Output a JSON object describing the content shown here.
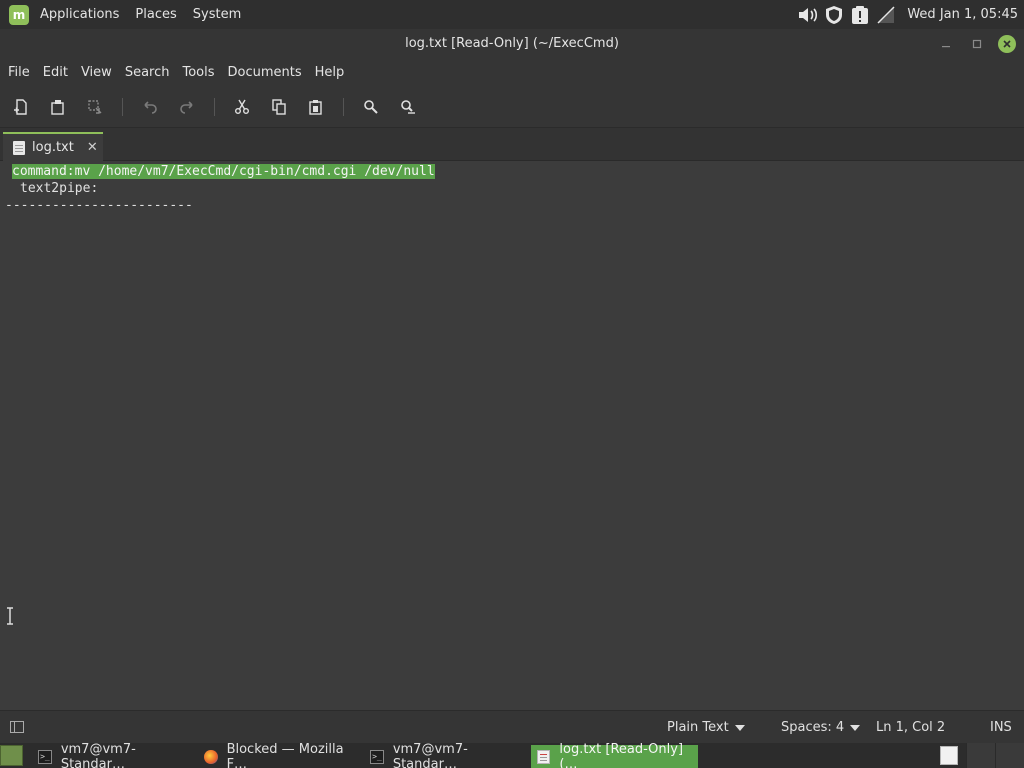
{
  "top_panel": {
    "menus": [
      "Applications",
      "Places",
      "System"
    ],
    "tray_icons": [
      "volume-icon",
      "shield-icon",
      "update-alert-icon",
      "network-offline-icon"
    ],
    "clock": "Wed Jan  1, 05:45"
  },
  "window": {
    "title": "log.txt [Read-Only] (~/ExecCmd)"
  },
  "menubar": {
    "items": [
      "File",
      "Edit",
      "View",
      "Search",
      "Tools",
      "Documents",
      "Help"
    ]
  },
  "tabs": [
    {
      "label": "log.txt",
      "close": "✕"
    }
  ],
  "editor": {
    "lines": [
      "command:mv /home/vm7/ExecCmd/cgi-bin/cmd.cgi /dev/null",
      "text2pipe:",
      "------------------------"
    ]
  },
  "statusbar": {
    "language": "Plain Text",
    "indent": "Spaces: 4",
    "position": "Ln 1, Col 2",
    "mode": "INS"
  },
  "taskbar": {
    "tasks": [
      {
        "label": "vm7@vm7-Standar…",
        "icon": "terminal-icon"
      },
      {
        "label": "Blocked — Mozilla F…",
        "icon": "firefox-icon"
      },
      {
        "label": "vm7@vm7-Standar…",
        "icon": "terminal-icon"
      },
      {
        "label": "log.txt [Read-Only] (…",
        "icon": "text-editor-icon"
      }
    ]
  },
  "colors": {
    "accent": "#8fbf5a",
    "selection": "#5aa24a",
    "editor_bg": "#3c3c3c"
  }
}
